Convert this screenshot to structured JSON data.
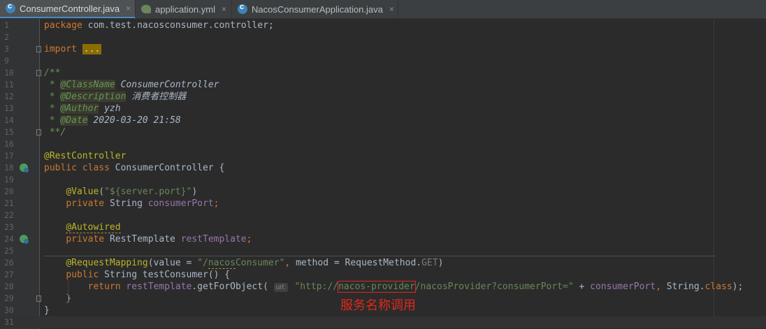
{
  "tabs": [
    {
      "label": "ConsumerController.java",
      "icon": "java-class-icon",
      "active": true
    },
    {
      "label": "application.yml",
      "icon": "yaml-file-icon",
      "active": false
    },
    {
      "label": "NacosConsumerApplication.java",
      "icon": "java-class-icon",
      "active": false
    }
  ],
  "close_glyph": "×",
  "annotation_note": "服务名称调用",
  "lines": [
    {
      "n": "1",
      "parts": [
        [
          "kw",
          "package "
        ],
        [
          "",
          "com.test.nacosconsumer.controller;"
        ]
      ]
    },
    {
      "n": "2",
      "parts": []
    },
    {
      "n": "3",
      "parts": [
        [
          "kw",
          "import "
        ],
        [
          "fold-dots",
          "..."
        ]
      ]
    },
    {
      "n": "9",
      "parts": []
    },
    {
      "n": "10",
      "parts": [
        [
          "doc",
          "/**"
        ]
      ]
    },
    {
      "n": "11",
      "parts": [
        [
          "doc",
          " * "
        ],
        [
          "doctag",
          "@ClassName"
        ],
        [
          "doctxt",
          " ConsumerController"
        ]
      ]
    },
    {
      "n": "12",
      "parts": [
        [
          "doc",
          " * "
        ],
        [
          "doctag",
          "@Description"
        ],
        [
          "doctxt",
          " 消费者控制器"
        ]
      ]
    },
    {
      "n": "13",
      "parts": [
        [
          "doc",
          " * "
        ],
        [
          "doctag",
          "@Author"
        ],
        [
          "doctxt",
          " yzh"
        ]
      ]
    },
    {
      "n": "14",
      "parts": [
        [
          "doc",
          " * "
        ],
        [
          "doctag",
          "@Date"
        ],
        [
          "doctxt",
          " 2020-03-20 21:58"
        ]
      ]
    },
    {
      "n": "15",
      "parts": [
        [
          "doc",
          " **/"
        ]
      ]
    },
    {
      "n": "16",
      "parts": []
    },
    {
      "n": "17",
      "parts": [
        [
          "ann",
          "@RestController"
        ]
      ]
    },
    {
      "n": "18",
      "parts": [
        [
          "kw",
          "public class "
        ],
        [
          "",
          "ConsumerController {"
        ]
      ]
    },
    {
      "n": "19",
      "parts": []
    },
    {
      "n": "20",
      "parts": [
        [
          "",
          "    "
        ],
        [
          "ann",
          "@Value"
        ],
        [
          "",
          "("
        ],
        [
          "str",
          "\"${server.port}\""
        ],
        [
          "",
          ")"
        ]
      ]
    },
    {
      "n": "21",
      "parts": [
        [
          "",
          "    "
        ],
        [
          "kw",
          "private "
        ],
        [
          "",
          "String "
        ],
        [
          "fld",
          "consumerPort"
        ],
        [
          "kw",
          ";"
        ]
      ]
    },
    {
      "n": "22",
      "parts": []
    },
    {
      "n": "23",
      "parts": [
        [
          "",
          "    "
        ],
        [
          "ann ul",
          "@Autowired"
        ]
      ]
    },
    {
      "n": "24",
      "parts": [
        [
          "",
          "    "
        ],
        [
          "kw",
          "private "
        ],
        [
          "",
          "RestTemplate "
        ],
        [
          "fld",
          "restTemplate"
        ],
        [
          "kw",
          ";"
        ]
      ]
    },
    {
      "n": "25",
      "parts": []
    },
    {
      "n": "26",
      "parts": [
        [
          "",
          "    "
        ],
        [
          "ann",
          "@RequestMapping"
        ],
        [
          "",
          "(value = "
        ],
        [
          "str",
          "\"/"
        ],
        [
          "str ul",
          "nacos"
        ],
        [
          "str",
          "Consumer\""
        ],
        [
          "kw",
          ", "
        ],
        [
          "",
          "method = RequestMethod."
        ],
        [
          "fld greyed",
          "GET"
        ],
        [
          "",
          ")"
        ]
      ]
    },
    {
      "n": "27",
      "parts": [
        [
          "",
          "    "
        ],
        [
          "kw",
          "public "
        ],
        [
          "",
          "String testConsumer() {"
        ]
      ]
    },
    {
      "n": "28",
      "parts": [
        [
          "",
          "        "
        ],
        [
          "kw",
          "return "
        ],
        [
          "fld",
          "restTemplate"
        ],
        [
          "",
          ".getForObject( "
        ],
        [
          "hint",
          "url:"
        ],
        [
          "str",
          " \"http://"
        ],
        [
          "str boxed",
          "nacos-provider"
        ],
        [
          "str",
          "/nacosProvider?consumerPort=\""
        ],
        [
          "",
          " + "
        ],
        [
          "fld",
          "consumerPort"
        ],
        [
          "kw",
          ", "
        ],
        [
          "",
          "String."
        ],
        [
          "kw",
          "class"
        ],
        [
          "",
          ");"
        ]
      ]
    },
    {
      "n": "29",
      "parts": [
        [
          "",
          "    }"
        ]
      ]
    },
    {
      "n": "30",
      "parts": [
        [
          "",
          "}"
        ]
      ]
    },
    {
      "n": "31",
      "parts": []
    }
  ]
}
